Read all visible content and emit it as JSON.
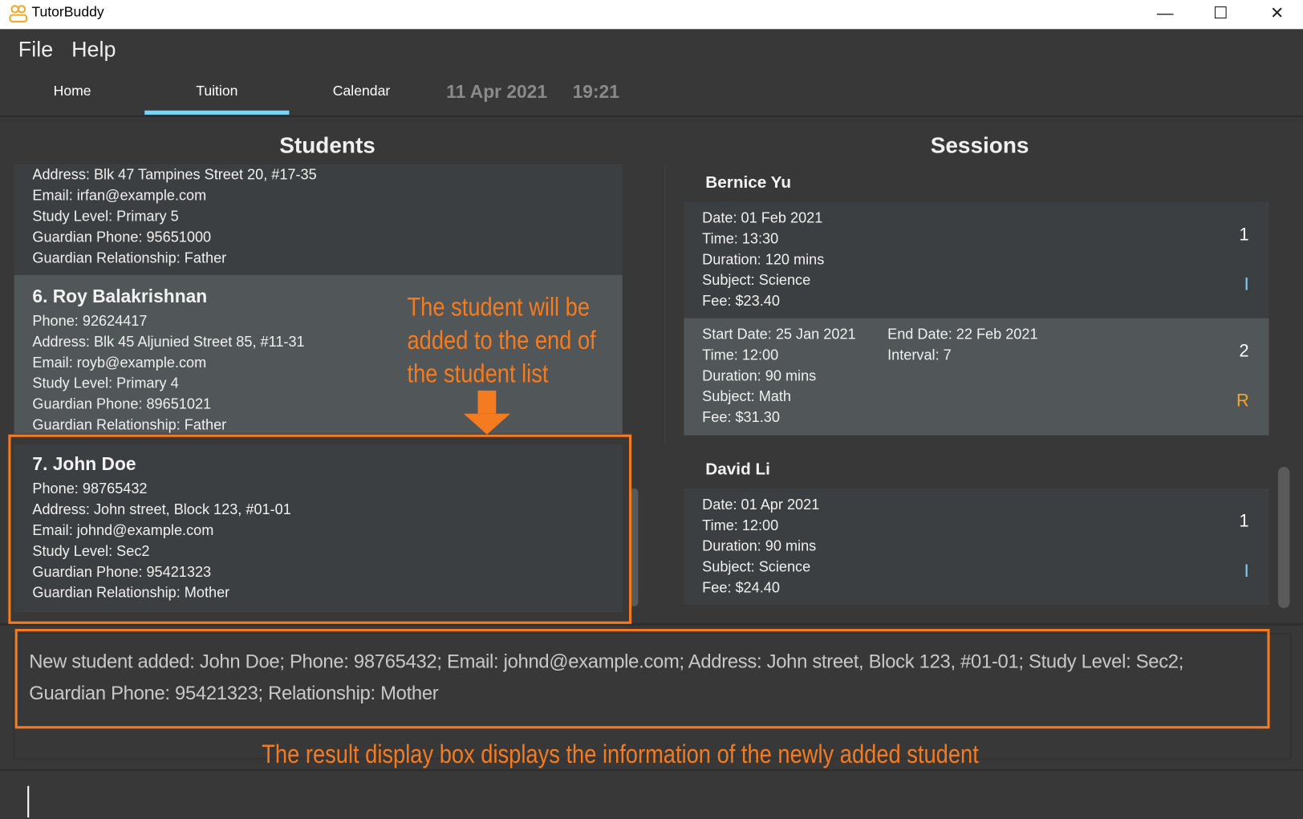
{
  "window": {
    "title": "TutorBuddy",
    "controls": [
      "minimize",
      "maximize",
      "close"
    ]
  },
  "menu": [
    "File",
    "Help"
  ],
  "tabs": [
    {
      "label": "Home"
    },
    {
      "label": "Tuition",
      "active": true
    },
    {
      "label": "Calendar"
    }
  ],
  "date": "11 Apr 2021",
  "time": "19:21",
  "colors": {
    "accent": "#7dd3f5",
    "annotation": "#f47b20",
    "recurring": "#f5a623"
  },
  "students": {
    "title": "Students",
    "items": [
      {
        "lines": [
          "Address: Blk 47 Tampines Street 20, #17-35",
          "Email: irfan@example.com",
          "Study Level: Primary 5",
          "Guardian Phone: 95651000",
          "Guardian Relationship: Father"
        ]
      },
      {
        "name": "6.  Roy Balakrishnan",
        "lines": [
          "Phone: 92624417",
          "Address: Blk 45 Aljunied Street 85, #11-31",
          "Email: royb@example.com",
          "Study Level: Primary 4",
          "Guardian Phone: 89651021",
          "Guardian Relationship: Father"
        ]
      },
      {
        "name": "7.  John Doe",
        "lines": [
          "Phone: 98765432",
          "Address: John street, Block 123, #01-01",
          "Email: johnd@example.com",
          "Study Level: Sec2",
          "Guardian Phone: 95421323",
          "Guardian Relationship: Mother"
        ]
      }
    ]
  },
  "sessions": {
    "title": "Sessions",
    "tutees": [
      {
        "name": "Bernice Yu",
        "sessions": [
          {
            "lines": [
              "Date: 01 Feb 2021",
              "Time: 13:30",
              "Duration: 120 mins",
              "Subject: Science",
              "Fee: $23.40"
            ],
            "index": "1",
            "type": "I"
          },
          {
            "lines": [
              "Start Date: 25 Jan 2021",
              "Time: 12:00",
              "Duration: 90 mins",
              "Subject: Math",
              "Fee: $31.30"
            ],
            "extra": [
              "End Date: 22 Feb 2021",
              "Interval: 7"
            ],
            "index": "2",
            "type": "R"
          }
        ]
      },
      {
        "name": "David Li",
        "sessions": [
          {
            "lines": [
              "Date: 01 Apr 2021",
              "Time: 12:00",
              "Duration: 90 mins",
              "Subject: Science",
              "Fee: $24.40"
            ],
            "index": "1",
            "type": "I"
          }
        ]
      }
    ]
  },
  "result": {
    "lines": [
      "New student added: John Doe; Phone: 98765432; Email: johnd@example.com; Address: John street, Block 123, #01-01; Study Level: Sec2;",
      "Guardian Phone: 95421323; Relationship: Mother"
    ]
  },
  "command": {
    "value": ""
  },
  "annotations": {
    "student_note": [
      "The student will be",
      "added to the end of",
      "the student list"
    ],
    "result_note": "The result display box displays the information of the newly added student"
  }
}
